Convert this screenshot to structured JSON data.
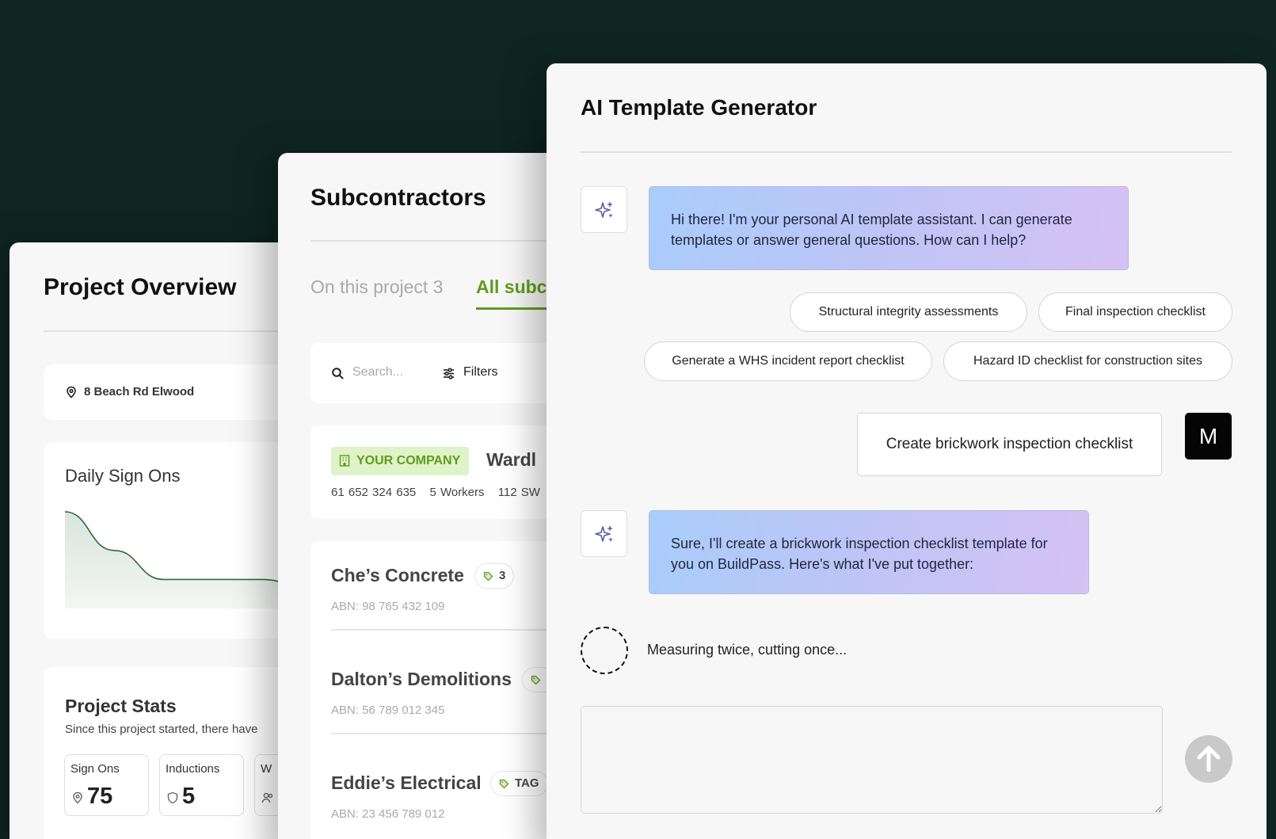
{
  "overview": {
    "title": "Project Overview",
    "address": "8 Beach Rd Elwood",
    "chart_title": "Daily Sign Ons",
    "stats_title": "Project Stats",
    "stats_subtitle": "Since this project started, there have",
    "stats": [
      {
        "label": "Sign Ons",
        "value": "75",
        "icon": "location-pin-icon"
      },
      {
        "label": "Inductions",
        "value": "5",
        "icon": "shield-icon"
      },
      {
        "label": "W",
        "value": "",
        "icon": "users-icon"
      }
    ]
  },
  "subcontractors": {
    "title": "Subcontractors",
    "tabs": [
      {
        "label": "On this project 3",
        "active": false
      },
      {
        "label": "All subc",
        "active": true
      }
    ],
    "search_placeholder": "Search...",
    "filters_label": "Filters",
    "company": {
      "badge": "YOUR COMPANY",
      "name": "Wardl",
      "abn": "61 652 324 635",
      "workers": "5 Workers",
      "address": "112 SW"
    },
    "items": [
      {
        "name": "Che’s Concrete",
        "tag": "3",
        "abn": "ABN: 98 765 432 109"
      },
      {
        "name": "Dalton’s Demolitions",
        "tag": "",
        "abn": "ABN: 56 789 012 345"
      },
      {
        "name": "Eddie’s Electrical",
        "tag": "TAG",
        "abn": "ABN: 23 456 789 012"
      }
    ]
  },
  "ai": {
    "title": "AI Template Generator",
    "greeting": "Hi there! I'm your personal AI template assistant. I can generate templates or answer general questions. How can I help?",
    "suggestions": [
      "Structural integrity assessments",
      "Final inspection checklist",
      "Generate a WHS incident report checklist",
      "Hazard ID checklist for construction sites"
    ],
    "user_message": "Create brickwork inspection checklist",
    "user_initial": "M",
    "reply": "Sure, I'll create a brickwork inspection checklist template for you on BuildPass. Here's what I've put together:",
    "loading_text": "Measuring twice, cutting once...",
    "composer_placeholder": ""
  },
  "colors": {
    "background": "#0f2620",
    "accent_green": "#5e9c1c",
    "badge_bg": "#dff2c8",
    "chart_line": "#2f6b3a"
  },
  "chart_data": {
    "type": "area",
    "title": "Daily Sign Ons",
    "xlabel": "",
    "ylabel": "",
    "values": [
      10,
      6,
      3,
      3,
      3,
      2,
      1
    ],
    "grid": false
  }
}
